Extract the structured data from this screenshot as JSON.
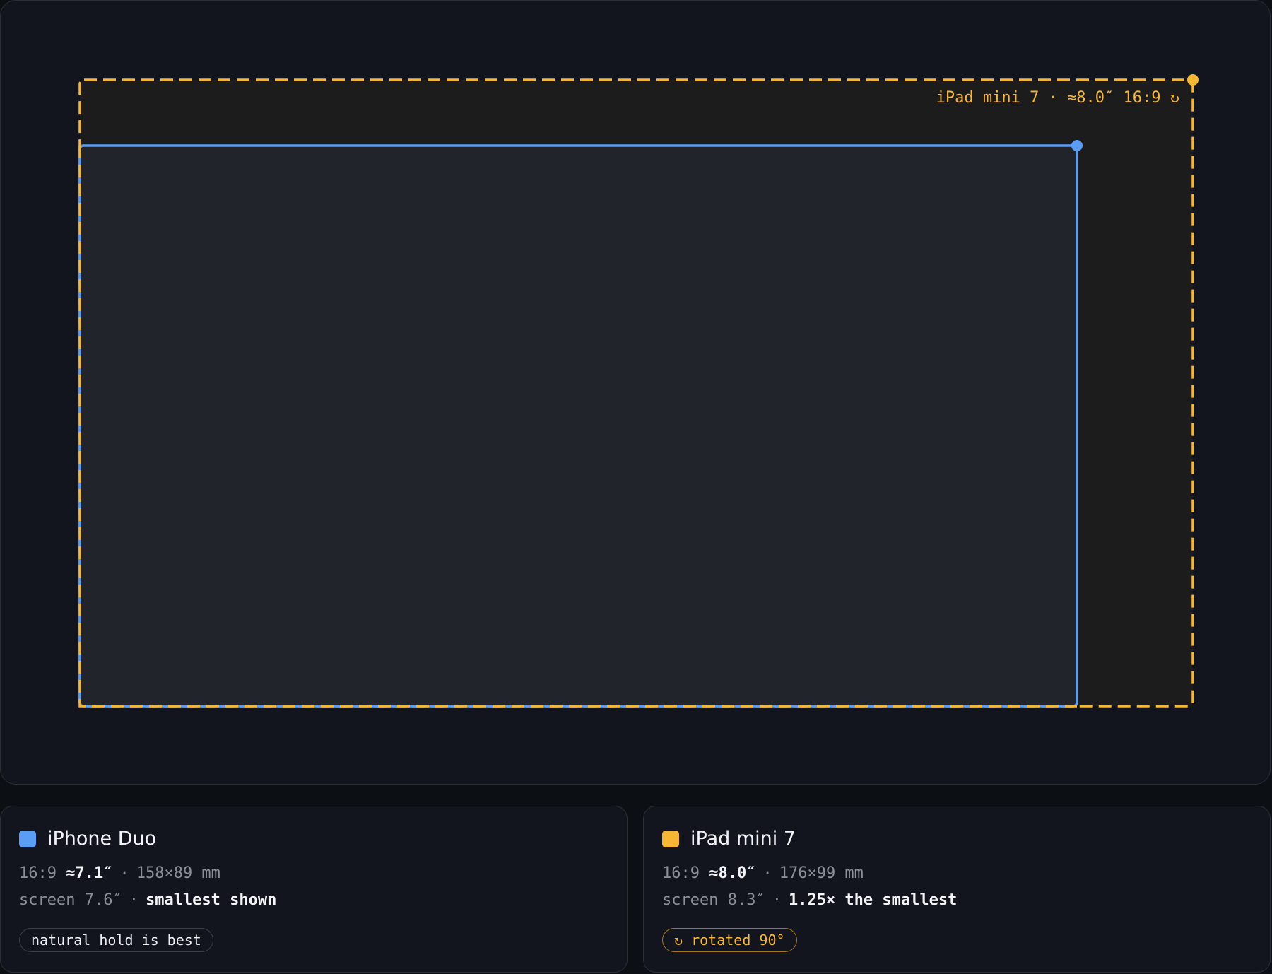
{
  "colors": {
    "iphone": "#5b9cf5",
    "ipad": "#f7b733",
    "stage_bg": "#12151d",
    "ipad_fill": "#1c1c1c",
    "iphone_fill": "#21242a"
  },
  "stage": {
    "outer_label": "iPad mini 7 · ≈8.0″ 16:9 ↻"
  },
  "cards": [
    {
      "name": "iPhone Duo",
      "color": "#5b9cf5",
      "ratio": "16:9",
      "diagonal": "≈7.1″",
      "dims": "158×89 mm",
      "screen": "screen 7.6″",
      "note": "smallest shown",
      "pill": "natural hold is best"
    },
    {
      "name": "iPad mini 7",
      "color": "#f7b733",
      "ratio": "16:9",
      "diagonal": "≈8.0″",
      "dims": "176×99 mm",
      "screen": "screen 8.3″",
      "note": "1.25× the smallest",
      "pill": "↻ rotated 90°"
    }
  ]
}
